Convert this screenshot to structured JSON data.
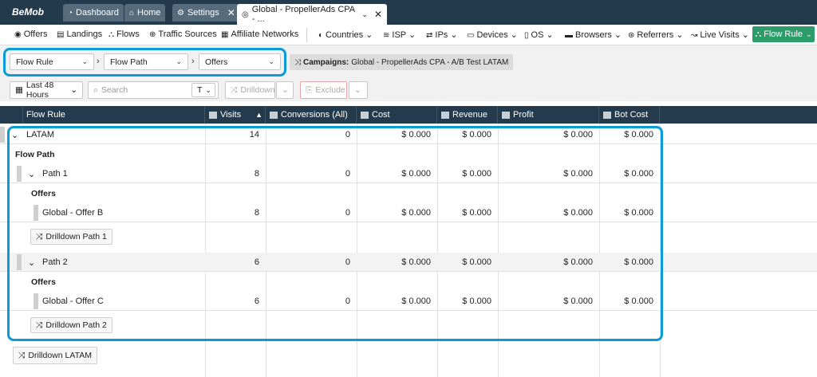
{
  "top_tabs": {
    "logo": "BeMob",
    "dashboard": "Dashboard",
    "home": "Home",
    "settings": "Settings",
    "active_tab": "Global - PropellerAds CPA - ..."
  },
  "nav": {
    "offers": "Offers",
    "landings": "Landings",
    "flows": "Flows",
    "traffic_sources": "Traffic Sources",
    "affiliate_networks": "Affiliate Networks",
    "countries": "Countries",
    "isp": "ISP",
    "ips": "IPs",
    "devices": "Devices",
    "os": "OS",
    "browsers": "Browsers",
    "referrers": "Referrers",
    "live_visits": "Live Visits",
    "flow_rule": "Flow Rule"
  },
  "breadcrumb": {
    "level1": "Flow Rule",
    "level2": "Flow Path",
    "level3": "Offers",
    "campaign_label": "Campaigns:",
    "campaign_value": "Global - PropellerAds CPA - A/B Test LATAM"
  },
  "toolbar": {
    "date_range": "Last 48 Hours",
    "search_placeholder": "Search",
    "search_mode": "T",
    "drilldown": "Drilldown",
    "exclude": "Exclude"
  },
  "columns": [
    "Flow Rule",
    "Visits",
    "Conversions (All)",
    "Cost",
    "Revenue",
    "Profit",
    "Bot Cost"
  ],
  "rows": {
    "latam": {
      "name": "LATAM",
      "visits": "14",
      "conversions": "0",
      "cost": "$ 0.000",
      "revenue": "$ 0.000",
      "profit": "$ 0.000",
      "bot_cost": "$ 0.000"
    },
    "flow_path_label": "Flow Path",
    "path1": {
      "name": "Path 1",
      "visits": "8",
      "conversions": "0",
      "cost": "$ 0.000",
      "revenue": "$ 0.000",
      "profit": "$ 0.000",
      "bot_cost": "$ 0.000"
    },
    "offers_label_1": "Offers",
    "offer_b": {
      "name": "Global - Offer B",
      "visits": "8",
      "conversions": "0",
      "cost": "$ 0.000",
      "revenue": "$ 0.000",
      "profit": "$ 0.000",
      "bot_cost": "$ 0.000"
    },
    "drilldown_path1": "Drilldown Path 1",
    "path2": {
      "name": "Path 2",
      "visits": "6",
      "conversions": "0",
      "cost": "$ 0.000",
      "revenue": "$ 0.000",
      "profit": "$ 0.000",
      "bot_cost": "$ 0.000"
    },
    "offers_label_2": "Offers",
    "offer_c": {
      "name": "Global - Offer C",
      "visits": "6",
      "conversions": "0",
      "cost": "$ 0.000",
      "revenue": "$ 0.000",
      "profit": "$ 0.000",
      "bot_cost": "$ 0.000"
    },
    "drilldown_path2": "Drilldown Path 2",
    "drilldown_latam": "Drilldown LATAM"
  },
  "colors": {
    "header_bg": "#243b4d",
    "topbar_bg": "#233a4c",
    "accent_green": "#2b9c6a",
    "highlight_blue": "#0b9bd7"
  }
}
